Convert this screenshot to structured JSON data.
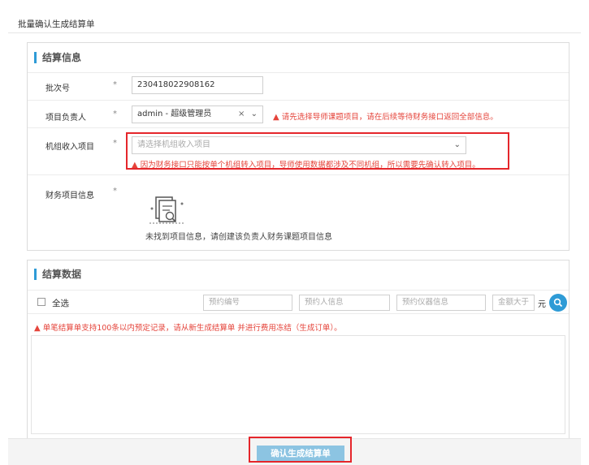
{
  "window_title": "批量确认生成结算单",
  "settlement_info": {
    "section_title": "结算信息",
    "batch_no": {
      "label": "批次号",
      "required_mark": "*",
      "value": "230418022908162"
    },
    "project_lead": {
      "label": "项目负责人",
      "required_mark": "*",
      "value": "admin - 超级管理员",
      "clear_glyph": "×",
      "warning": "请先选择导师课题项目，请在后续等待财务接口返回全部信息。"
    },
    "org_income_project": {
      "label": "机组收入项目",
      "required_mark": "*",
      "placeholder": "请选择机组收入项目",
      "warning": "因为财务接口只能按单个机组转入项目，导师使用数据都涉及不同机组，所以需要先确认转入项目。"
    },
    "finance_project_info": {
      "label": "财务项目信息",
      "required_mark": "*",
      "empty_text": "未找到项目信息，请创建该负责人财务课题项目信息"
    }
  },
  "settlement_data": {
    "section_title": "结算数据",
    "select_all_label": "全选",
    "filters": {
      "booking_no_placeholder": "预约编号",
      "booker_placeholder": "预约人信息",
      "instrument_placeholder": "预约仪器信息",
      "amount_placeholder": "金额大于",
      "amount_unit": "元"
    },
    "limit_warning": "单笔结算单支持100条以内预定记录，请从新生成结算单 并进行费用冻结（生成订单）。"
  },
  "footer": {
    "confirm_button": "确认生成结算单"
  },
  "colors": {
    "accent": "#2e9bd6",
    "warning": "#e5443b",
    "highlight_box": "#e5262b",
    "button_bg": "#8cc4e2"
  },
  "icons": {
    "warning": "warning-triangle-icon",
    "search": "search-icon",
    "empty": "empty-document-icon",
    "dropdown": "chevron-down-icon"
  }
}
